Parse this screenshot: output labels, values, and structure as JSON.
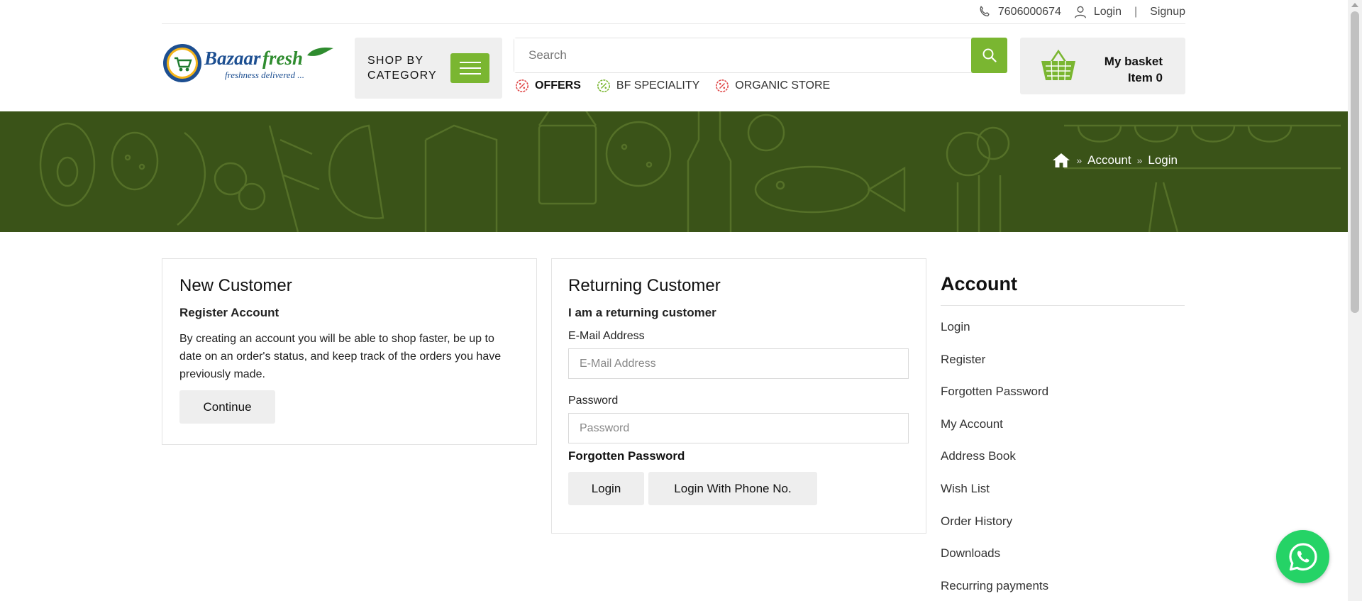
{
  "topbar": {
    "phone": "7606000674",
    "login": "Login",
    "separator": "|",
    "signup": "Signup"
  },
  "header": {
    "logo_brand_a": "Bazaar",
    "logo_brand_b": "fresh",
    "logo_tagline": "freshness delivered ...",
    "shop_by_line1": "SHOP BY",
    "shop_by_line2": "CATEGORY",
    "search_placeholder": "Search",
    "quicklinks": [
      {
        "label": "OFFERS",
        "icon": "discount-icon",
        "color": "#e04848"
      },
      {
        "label": "BF SPECIALITY",
        "icon": "discount-icon",
        "color": "#7ab631"
      },
      {
        "label": "ORGANIC STORE",
        "icon": "discount-icon",
        "color": "#e04848"
      }
    ],
    "basket_title": "My basket",
    "basket_items": "Item 0"
  },
  "breadcrumb": {
    "home_icon": "home-icon",
    "items": [
      "Account",
      "Login"
    ]
  },
  "new_customer": {
    "title": "New Customer",
    "subtitle": "Register Account",
    "text": "By creating an account you will be able to shop faster, be up to date on an order's status, and keep track of the orders you have previously made.",
    "button": "Continue"
  },
  "returning_customer": {
    "title": "Returning Customer",
    "subtitle": "I am a returning customer",
    "email_label": "E-Mail Address",
    "email_placeholder": "E-Mail Address",
    "password_label": "Password",
    "password_placeholder": "Password",
    "forgotten": "Forgotten Password",
    "login_button": "Login",
    "phone_login_button": "Login With Phone No."
  },
  "account_sidebar": {
    "title": "Account",
    "items": [
      "Login",
      "Register",
      "Forgotten Password",
      "My Account",
      "Address Book",
      "Wish List",
      "Order History",
      "Downloads",
      "Recurring payments"
    ]
  },
  "colors": {
    "accent_green": "#7ab631",
    "banner_green": "#3a5318",
    "whatsapp_green": "#25d366"
  }
}
